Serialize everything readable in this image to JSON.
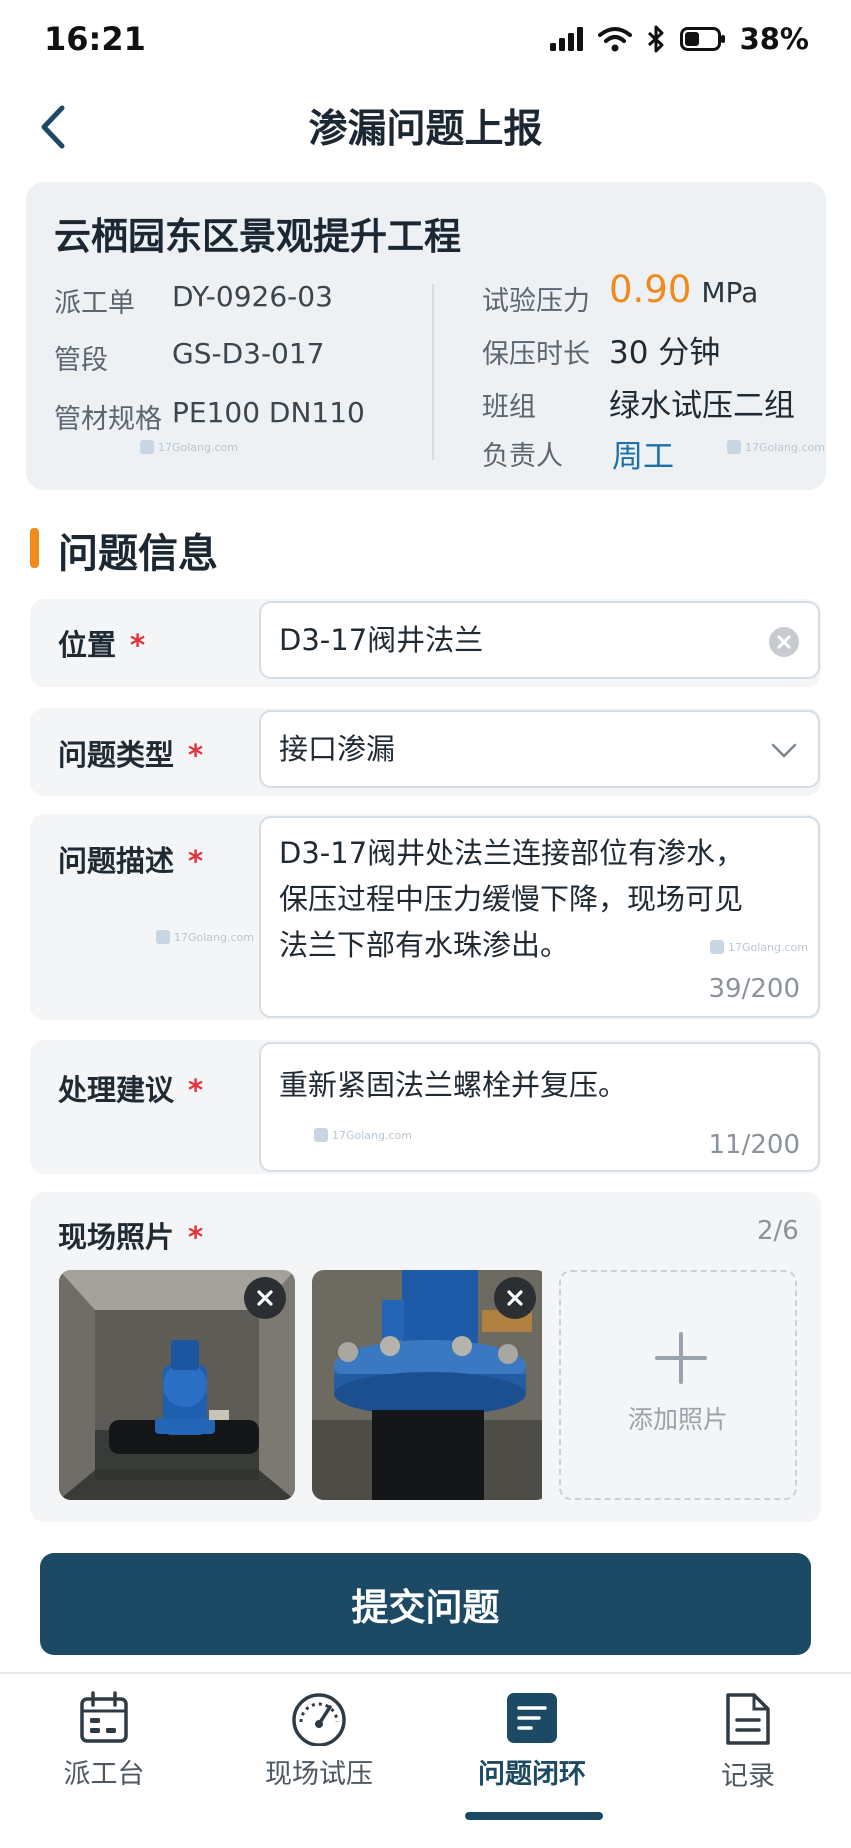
{
  "status": {
    "time": "16:21",
    "battery": "38%"
  },
  "header": {
    "title": "渗漏问题上报"
  },
  "project": {
    "name": "云栖园东区景观提升工程",
    "left": [
      {
        "label": "派工单",
        "value": "DY-0926-03"
      },
      {
        "label": "管段",
        "value": "GS-D3-017"
      },
      {
        "label": "管材规格",
        "value": "PE100  DN110"
      }
    ],
    "pressure_label": "试验压力",
    "pressure_value": "0.90",
    "pressure_unit": "MPa",
    "hold_label": "保压时长",
    "hold_value": "30 分钟",
    "team_label": "班组",
    "team_value": "绿水试压二组",
    "leader_label": "负责人",
    "leader_value": "周工"
  },
  "section": {
    "title": "问题信息"
  },
  "form": {
    "location": {
      "label": "位置",
      "required": "*",
      "value": "D3-17阀井法兰"
    },
    "type": {
      "label": "问题类型",
      "required": "*",
      "value": "接口渗漏"
    },
    "description": {
      "label": "问题描述",
      "required": "*",
      "line1": "D3-17阀井处法兰连接部位有渗水，",
      "line2": "保压过程中压力缓慢下降，现场可见",
      "line3": "法兰下部有水珠渗出。",
      "counter": "39/200"
    },
    "suggestion": {
      "label": "处理建议",
      "required": "*",
      "value": "重新紧固法兰螺栓并复压。",
      "counter": "11/200"
    },
    "photos": {
      "label": "现场照片",
      "required": "*",
      "counter": "2/6",
      "add_label": "添加照片"
    }
  },
  "submit": {
    "label": "提交问题"
  },
  "tabs": [
    {
      "label": "派工台",
      "icon": "calendar-icon",
      "active": false
    },
    {
      "label": "现场试压",
      "icon": "gauge-icon",
      "active": false
    },
    {
      "label": "问题闭环",
      "icon": "document-lines-icon",
      "active": true
    },
    {
      "label": "记录",
      "icon": "records-icon",
      "active": false
    }
  ],
  "watermark": "17Golang.com",
  "colors": {
    "accent": "#f08a1c",
    "primary": "#1c4a64",
    "link": "#1c6fa8",
    "required": "#e0343a"
  }
}
